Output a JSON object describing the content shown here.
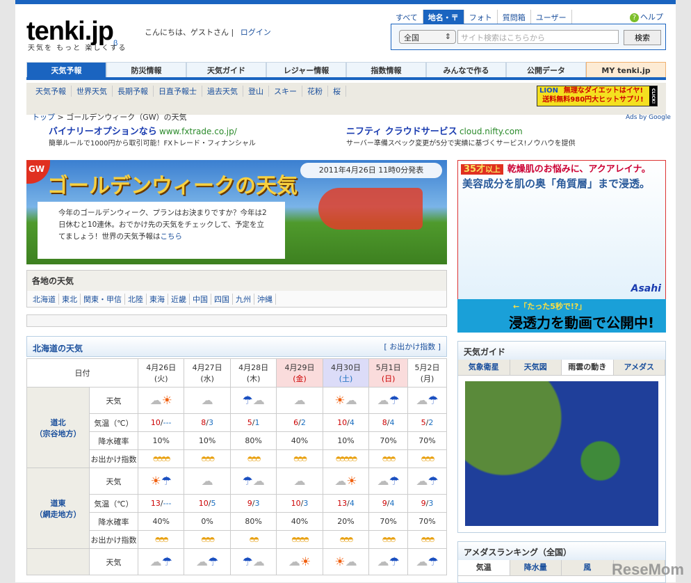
{
  "header": {
    "logo": "tenki.jp",
    "beta": "β",
    "tagline": "天気を もっと 楽しくする",
    "greeting": "こんにちは、ゲストさん",
    "login": "ログイン",
    "help": "ヘルプ",
    "search_tabs": [
      "すべて",
      "地名・〒",
      "フォト",
      "質問箱",
      "ユーザー"
    ],
    "search_scope": "全国",
    "search_placeholder": "サイト検索はこちらから",
    "search_button": "検索"
  },
  "nav": [
    "天気予報",
    "防災情報",
    "天気ガイド",
    "レジャー情報",
    "指数情報",
    "みんなで作る",
    "公開データ",
    "MY tenki.jp"
  ],
  "subnav": [
    "天気予報",
    "世界天気",
    "長期予報",
    "日直予報士",
    "過去天気",
    "登山",
    "スキー",
    "花粉",
    "桜"
  ],
  "lion_ad": {
    "brand": "LION",
    "line1": "無理なダイエットはイヤ!",
    "line2": "送料無料980円大ヒットサプリ!",
    "click": "CLICK!"
  },
  "breadcrumb": {
    "top": "トップ",
    "current": "ゴールデンウィーク（GW）の天気"
  },
  "ads_by": "Ads by Google",
  "ads": [
    {
      "title": "バイナリーオプションなら",
      "url": "www.fxtrade.co.jp/",
      "desc": "簡単ルールで1000円から取引可能！FXトレード・フィナンシャル"
    },
    {
      "title": "ニフティ クラウドサービス",
      "url": "cloud.nifty.com",
      "desc": "サーバー準備スペック変更が5分で実績に基づくサービス!ノウハウを提供"
    }
  ],
  "banner": {
    "badge": "GW",
    "title": "ゴールデンウィークの天気",
    "published": "2011年4月26日 11時0分発表",
    "intro": "今年のゴールデンウィーク、プランはお決まりですか？今年は2日休むと10連休。おでかけ先の天気をチェックして、予定を立てましょう！世界の天気予報は",
    "intro_link": "こちら"
  },
  "areas": {
    "title": "各地の天気",
    "links": [
      "北海道",
      "東北",
      "関東・甲信",
      "北陸",
      "東海",
      "近畿",
      "中国",
      "四国",
      "九州",
      "沖縄"
    ]
  },
  "forecast": {
    "title": "北海道の天気",
    "index_link": "[ お出かけ指数 ]",
    "date_header": "日付",
    "days": [
      {
        "date": "4月26日",
        "dow": "(火)",
        "type": ""
      },
      {
        "date": "4月27日",
        "dow": "(水)",
        "type": ""
      },
      {
        "date": "4月28日",
        "dow": "(木)",
        "type": ""
      },
      {
        "date": "4月29日",
        "dow": "(金)",
        "type": "hol"
      },
      {
        "date": "4月30日",
        "dow": "(土)",
        "type": "sat"
      },
      {
        "date": "5月1日",
        "dow": "(日)",
        "type": "hol"
      },
      {
        "date": "5月2日",
        "dow": "(月)",
        "type": ""
      }
    ],
    "row_labels": {
      "weather": "天気",
      "temp": "気温（℃）",
      "rain": "降水確率",
      "index": "お出かけ指数"
    },
    "regions": [
      {
        "name": "道北",
        "sub": "（宗谷地方）",
        "weather": [
          "cloudy-then-sunny",
          "cloudy",
          "rain-then-cloudy",
          "cloudy",
          "sunny-then-cloudy",
          "cloudy-then-rain",
          "cloudy-then-rain"
        ],
        "high": [
          "10",
          "8",
          "5",
          "6",
          "10",
          "8",
          "5"
        ],
        "low": [
          "---",
          "3",
          "1",
          "2",
          "4",
          "4",
          "2"
        ],
        "rain": [
          "10%",
          "10%",
          "80%",
          "40%",
          "10%",
          "70%",
          "70%"
        ],
        "index": [
          4,
          3,
          3,
          3,
          5,
          3,
          3
        ]
      },
      {
        "name": "道東",
        "sub": "（網走地方）",
        "weather": [
          "sunny-then-rain",
          "cloudy",
          "rain-then-cloudy",
          "cloudy",
          "cloudy-then-sunny",
          "cloudy-then-rain",
          "cloudy-then-rain"
        ],
        "high": [
          "13",
          "10",
          "9",
          "10",
          "13",
          "9",
          "9"
        ],
        "low": [
          "---",
          "5",
          "3",
          "3",
          "4",
          "4",
          "3"
        ],
        "rain": [
          "40%",
          "0%",
          "80%",
          "40%",
          "20%",
          "70%",
          "70%"
        ],
        "index": [
          3,
          3,
          2,
          4,
          3,
          3,
          3
        ]
      },
      {
        "name": "",
        "sub": "",
        "weather": [
          "cloudy-then-rain",
          "cloudy-then-rain",
          "rain-then-cloudy",
          "cloudy-then-sunny",
          "sunny-then-cloudy",
          "cloudy-then-rain",
          "cloudy-then-rain"
        ]
      }
    ]
  },
  "skin_ad": {
    "age": "35才",
    "age_suffix": "以上",
    "headline": "乾燥肌のお悩みに、アクアレイナ。",
    "sub": "美容成分を肌の奥「角質層」まで浸透。",
    "bottom_small": "←「たった5秒で!?」",
    "bottom": "浸透力を動画で公開中!",
    "brand": "Asahi"
  },
  "guide": {
    "title": "天気ガイド",
    "tabs": [
      "気象衛星",
      "天気図",
      "雨雲の動き",
      "アメダス"
    ],
    "active": 2
  },
  "ranking": {
    "title": "アメダスランキング（全国）",
    "tabs": [
      "気温",
      "降水量",
      "風",
      ""
    ],
    "active": 0
  },
  "watermark": "ReseMom"
}
